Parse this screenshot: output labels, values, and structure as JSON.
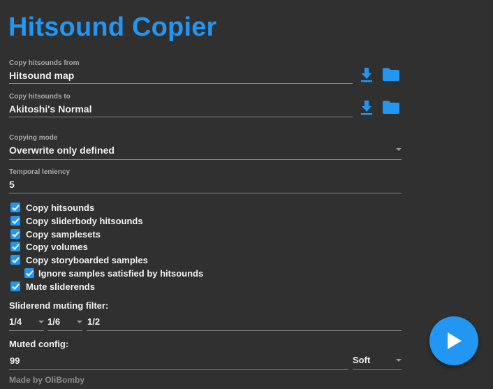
{
  "app": {
    "title": "Hitsound Copier",
    "accent": "#2196f3",
    "footer": "Made by OliBomby"
  },
  "fields": {
    "from": {
      "label": "Copy hitsounds from",
      "value": "Hitsound map",
      "icons": [
        "download-icon",
        "folder-icon"
      ]
    },
    "to": {
      "label": "Copy hitsounds to",
      "value": "Akitoshi's Normal",
      "icons": [
        "download-icon",
        "folder-icon"
      ]
    },
    "mode": {
      "label": "Copying mode",
      "value": "Overwrite only defined"
    },
    "leniency": {
      "label": "Temporal leniency",
      "value": "5"
    }
  },
  "checkboxes": [
    {
      "label": "Copy hitsounds",
      "checked": true
    },
    {
      "label": "Copy sliderbody hitsounds",
      "checked": true
    },
    {
      "label": "Copy samplesets",
      "checked": true
    },
    {
      "label": "Copy volumes",
      "checked": true
    },
    {
      "label": "Copy storyboarded samples",
      "checked": true
    },
    {
      "label": "Ignore samples satisfied by hitsounds",
      "checked": true
    },
    {
      "label": "Mute sliderends",
      "checked": true
    }
  ],
  "sliderend_filter": {
    "label": "Sliderend muting filter:",
    "option1": "1/4",
    "option2": "1/6",
    "option3": "1/2"
  },
  "muted_config": {
    "label": "Muted config:",
    "value": "99",
    "sampleset": "Soft"
  },
  "run_button": {
    "icon": "play-icon"
  }
}
